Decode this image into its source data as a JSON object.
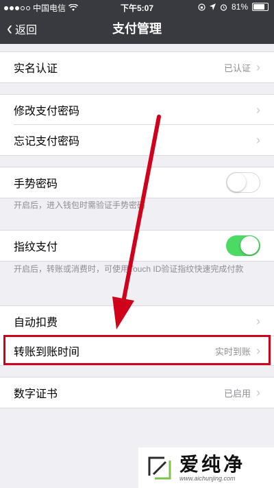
{
  "status_bar": {
    "carrier": "中国电信",
    "time": "下午5:07",
    "battery": "81%",
    "battery_level": 0.81
  },
  "nav": {
    "back_label": "返回",
    "title": "支付管理"
  },
  "rows": {
    "real_name": {
      "label": "实名认证",
      "value": "已认证"
    },
    "modify_password": {
      "label": "修改支付密码"
    },
    "forgot_password": {
      "label": "忘记支付密码"
    },
    "gesture_password": {
      "label": "手势密码",
      "enabled": false
    },
    "gesture_hint": "开启后，进入钱包时需验证手势密码",
    "fingerprint_pay": {
      "label": "指纹支付",
      "enabled": true
    },
    "fingerprint_hint": "开启后，转账或消费时，可使用Touch ID验证指纹快速完成付款",
    "auto_deduct": {
      "label": "自动扣费"
    },
    "transfer_time": {
      "label": "转账到账时间",
      "value": "实时到账"
    },
    "digital_cert": {
      "label": "数字证书",
      "value": "已启用"
    }
  },
  "colors": {
    "nav_bg": "#393a3f",
    "page_bg": "#efeff4",
    "toggle_on": "#4cd964",
    "annotation_red": "#d0021b"
  },
  "watermark": {
    "brand": "爱纯净",
    "url": "www.aichunjing.com"
  }
}
